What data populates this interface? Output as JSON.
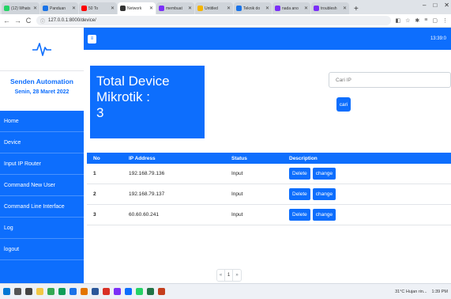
{
  "browser": {
    "tabs": [
      {
        "label": "(12) Whats",
        "color": "#25d366"
      },
      {
        "label": "Panduan",
        "color": "#1a73e8"
      },
      {
        "label": "50 To",
        "color": "#ff0000"
      },
      {
        "label": "Network",
        "color": "#333333"
      },
      {
        "label": "membuat",
        "color": "#7b2ff7"
      },
      {
        "label": "Untitled",
        "color": "#f4b400"
      },
      {
        "label": "Teknik do",
        "color": "#1a73e8"
      },
      {
        "label": "nada ano",
        "color": "#7b2ff7"
      },
      {
        "label": "troublesh",
        "color": "#7b2ff7"
      }
    ],
    "active_tab_index": 3,
    "new_tab": "+",
    "url": "127.0.0.1:8000/device/",
    "back": "←",
    "forward": "→",
    "reload": "C",
    "info": "ⓘ",
    "win_min": "–",
    "win_max": "□",
    "win_close": "✕",
    "tab_close": "✕",
    "ext_icons": [
      "◧",
      "☆",
      "✱",
      "≡",
      "▢",
      "⋮"
    ]
  },
  "app": {
    "company": "Senden Automation",
    "date": "Senin, 28 Maret 2022",
    "menu": [
      "Home",
      "Device",
      "Input IP Router",
      "Command New User",
      "Command Line Interface",
      "Log",
      "logout"
    ],
    "toggle_symbol": "≡",
    "clock": "13:39:0"
  },
  "card": {
    "line1": "Total Device",
    "line2": "Mikrotik :",
    "count": "3"
  },
  "search": {
    "placeholder": "Cari IP",
    "button": "cari"
  },
  "table": {
    "headers": [
      "No",
      "IP Address",
      "Status",
      "Description"
    ],
    "rows": [
      {
        "no": "1",
        "ip": "192.168.79.136",
        "status": "Input"
      },
      {
        "no": "2",
        "ip": "192.168.79.137",
        "status": "Input"
      },
      {
        "no": "3",
        "ip": "60.60.60.241",
        "status": "Input"
      }
    ],
    "delete_label": "Delete",
    "change_label": "change"
  },
  "pager": {
    "prev": "«",
    "page": "1",
    "next": "»"
  },
  "taskbar": {
    "weather": "31°C Hujan rin...",
    "time": "1:39 PM"
  },
  "colors": {
    "primary": "#0d6efd"
  }
}
